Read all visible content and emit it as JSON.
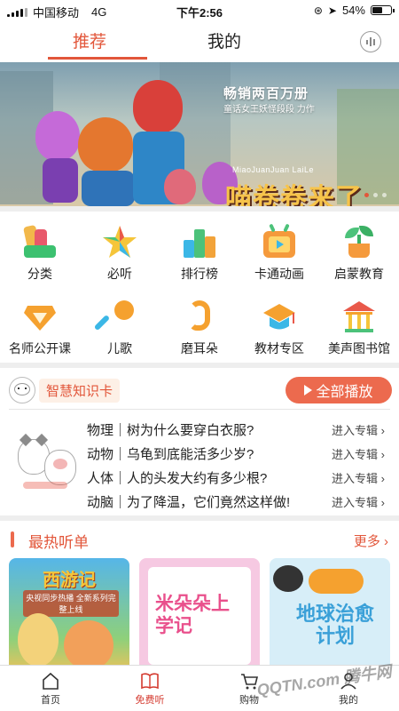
{
  "status_bar": {
    "carrier": "中国移动",
    "network": "4G",
    "time": "下午2:56",
    "battery": "54%",
    "battery_level": 0.54
  },
  "top_tabs": {
    "recommend": "推荐",
    "mine": "我的",
    "active": "recommend"
  },
  "banner": {
    "subtitle": "畅销两百万册",
    "subtitle2": "童话女王妖怪段段 力作",
    "pinyin": "MiaoJuanJuan LaiLe",
    "title": "喵卷卷来了",
    "slide_count": 3,
    "active_slide": 0
  },
  "categories": [
    {
      "label": "分类",
      "icon": "category-icon"
    },
    {
      "label": "必听",
      "icon": "star-icon"
    },
    {
      "label": "排行榜",
      "icon": "ranking-icon"
    },
    {
      "label": "卡通动画",
      "icon": "tv-icon"
    },
    {
      "label": "启蒙教育",
      "icon": "sprout-icon"
    },
    {
      "label": "名师公开课",
      "icon": "diamond-icon"
    },
    {
      "label": "儿歌",
      "icon": "microphone-icon"
    },
    {
      "label": "磨耳朵",
      "icon": "ear-icon"
    },
    {
      "label": "教材专区",
      "icon": "graduation-cap-icon"
    },
    {
      "label": "美声图书馆",
      "icon": "library-icon"
    }
  ],
  "knowledge_card": {
    "title": "智慧知识卡",
    "play_all": "全部播放",
    "items": [
      {
        "text": "物理｜树为什么要穿白衣服?",
        "action": "进入专辑"
      },
      {
        "text": "动物｜乌龟到底能活多少岁?",
        "action": "进入专辑"
      },
      {
        "text": "人体｜人的头发大约有多少根?",
        "action": "进入专辑"
      },
      {
        "text": "动脑｜为了降温，它们竟然这样做!",
        "action": "进入专辑"
      }
    ]
  },
  "hot_list": {
    "title": "最热听单",
    "more": "更多",
    "cards": [
      {
        "title": "西游记",
        "caption": "央视同步热播 全新系列完整上线"
      },
      {
        "title": "米朵朵上学记"
      },
      {
        "title": "地球治愈计划"
      }
    ]
  },
  "tab_bar": {
    "items": [
      {
        "label": "首页",
        "icon": "home-icon"
      },
      {
        "label": "免费听",
        "icon": "book-icon"
      },
      {
        "label": "购物",
        "icon": "cart-icon"
      },
      {
        "label": "我的",
        "icon": "person-icon"
      }
    ],
    "active": 1
  },
  "watermark": "QQTN.com 腾牛网",
  "colors": {
    "accent": "#e2563a",
    "play_button": "#ec6a4e"
  }
}
